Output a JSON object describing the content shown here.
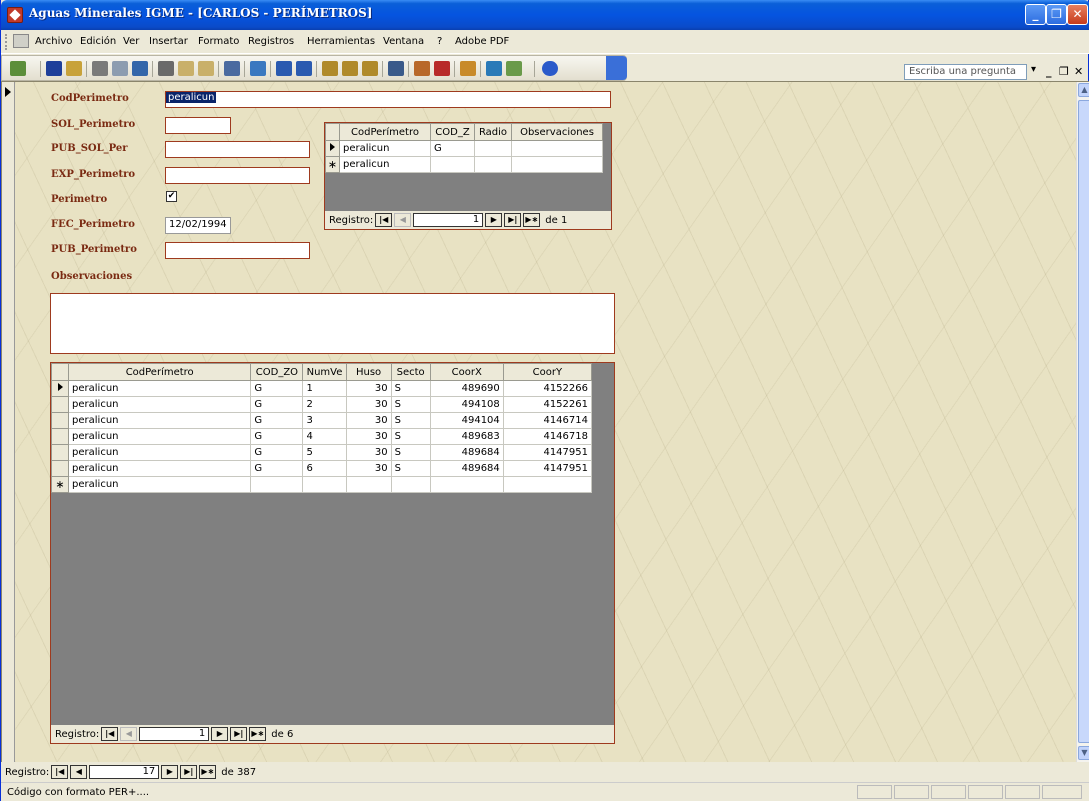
{
  "window": {
    "title": "Aguas Minerales IGME - [CARLOS - PERÍMETROS]"
  },
  "menu": [
    "Archivo",
    "Edición",
    "Ver",
    "Insertar",
    "Formato",
    "Registros",
    "Herramientas",
    "Ventana",
    "?",
    "Adobe PDF"
  ],
  "help_placeholder": "Escriba una pregunta",
  "form": {
    "labels": {
      "cod": "CodPerimetro",
      "sol": "SOL_Perimetro",
      "pub_sol": "PUB_SOL_Per",
      "exp": "EXP_Perimetro",
      "perimetro": "Perimetro",
      "fec": "FEC_Perimetro",
      "pub": "PUB_Perimetro",
      "obs": "Observaciones"
    },
    "values": {
      "cod": "peralicun",
      "sol": "",
      "pub_sol": "",
      "exp": "",
      "perimetro_checked": "✔",
      "fec": "12/02/1994",
      "pub": "",
      "obs": ""
    }
  },
  "subform1": {
    "columns": [
      "CodPerímetro",
      "COD_Z",
      "Radio",
      "Observaciones"
    ],
    "rows": [
      [
        "peralicun",
        "G",
        "",
        ""
      ],
      [
        "peralicun",
        "",
        "",
        ""
      ]
    ],
    "nav": {
      "label": "Registro:",
      "current": "1",
      "total": "de 1"
    }
  },
  "subform2": {
    "columns": [
      "CodPerímetro",
      "COD_ZO",
      "NumVe",
      "Huso",
      "Secto",
      "CoorX",
      "CoorY"
    ],
    "rows": [
      [
        "peralicun",
        "G",
        "1",
        "30",
        "S",
        "489690",
        "4152266"
      ],
      [
        "peralicun",
        "G",
        "2",
        "30",
        "S",
        "494108",
        "4152261"
      ],
      [
        "peralicun",
        "G",
        "3",
        "30",
        "S",
        "494104",
        "4146714"
      ],
      [
        "peralicun",
        "G",
        "4",
        "30",
        "S",
        "489683",
        "4146718"
      ],
      [
        "peralicun",
        "G",
        "5",
        "30",
        "S",
        "489684",
        "4147951"
      ],
      [
        "peralicun",
        "G",
        "6",
        "30",
        "S",
        "489684",
        "4147951"
      ],
      [
        "peralicun",
        "",
        "",
        "",
        "",
        "",
        ""
      ]
    ],
    "nav": {
      "label": "Registro:",
      "current": "1",
      "total": "de 6"
    }
  },
  "mainnav": {
    "label": "Registro:",
    "current": "17",
    "total": "de 387"
  },
  "status": "Código con formato PER+...."
}
